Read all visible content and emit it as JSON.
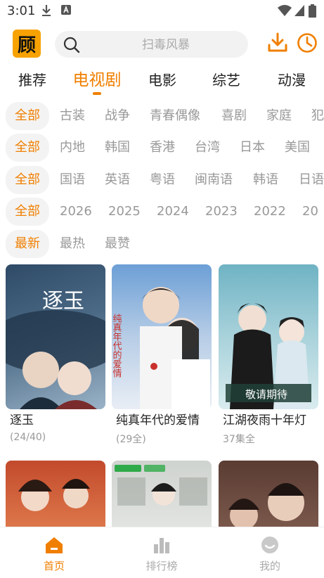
{
  "status_bar": {
    "time": "3:01"
  },
  "header": {
    "logo_char": "顾",
    "search_placeholder": "扫毒风暴"
  },
  "tabs": [
    "推荐",
    "电视剧",
    "电影",
    "综艺",
    "动漫"
  ],
  "active_tab": "电视剧",
  "filters": [
    [
      "全部",
      "古装",
      "战争",
      "青春偶像",
      "喜剧",
      "家庭",
      "犯"
    ],
    [
      "全部",
      "内地",
      "韩国",
      "香港",
      "台湾",
      "日本",
      "美国"
    ],
    [
      "全部",
      "国语",
      "英语",
      "粤语",
      "闽南语",
      "韩语",
      "日语"
    ],
    [
      "全部",
      "2026",
      "2025",
      "2024",
      "2023",
      "2022",
      "20"
    ],
    [
      "最新",
      "最热",
      "最赞"
    ]
  ],
  "cards": [
    {
      "title": "逐玉",
      "subtitle": "(24/40)",
      "poster_text": "逐玉",
      "colors": [
        "#2e4a66",
        "#9ab3c7"
      ]
    },
    {
      "title": "纯真年代的爱情",
      "subtitle": "(29全)",
      "poster_text": "纯真年代的爱情",
      "colors": [
        "#6c9fd6",
        "#e9eef5"
      ]
    },
    {
      "title": "江湖夜雨十年灯",
      "subtitle": "37集全",
      "poster_text": "敬请期待",
      "colors": [
        "#6fb3c4",
        "#d9ecef"
      ]
    },
    {
      "title": "",
      "subtitle": "",
      "poster_text": "",
      "colors": [
        "#c24a2c",
        "#f0b47a"
      ]
    },
    {
      "title": "",
      "subtitle": "",
      "poster_text": "",
      "colors": [
        "#cfd3cf",
        "#f4f4f2"
      ]
    },
    {
      "title": "",
      "subtitle": "",
      "poster_text": "",
      "colors": [
        "#5a3c33",
        "#a67b6a"
      ]
    }
  ],
  "bottom_nav": [
    {
      "label": "首页",
      "icon": "home-icon",
      "active": true
    },
    {
      "label": "排行榜",
      "icon": "ranking-icon",
      "active": false
    },
    {
      "label": "我的",
      "icon": "profile-icon",
      "active": false
    }
  ],
  "accent_color": "#f07f00"
}
